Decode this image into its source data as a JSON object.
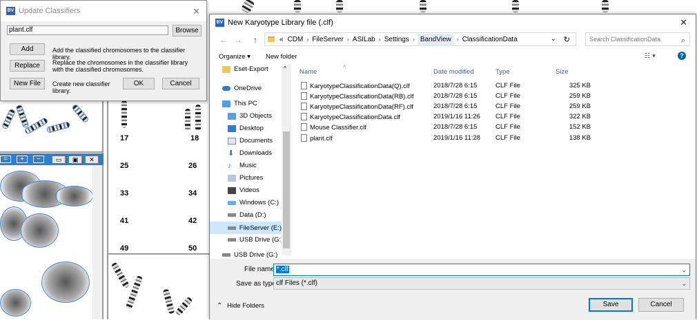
{
  "update_dialog": {
    "title": "Update Classifiers",
    "file_value": "plant.clf",
    "browse_label": "Browse",
    "add_label": "Add",
    "add_desc": "Add the classified chromosomes to the classifier library.",
    "replace_label": "Replace",
    "replace_desc": "Replace the chromosomes in the classifier library with the classified chromosomes.",
    "new_file_label": "New File",
    "new_file_desc": "Create new classifier library.",
    "ok_label": "OK",
    "cancel_label": "Cancel",
    "close_glyph": "✕"
  },
  "background": {
    "karyotype_numbers": [
      "17",
      "18",
      "25",
      "26",
      "33",
      "34",
      "41",
      "42",
      "49",
      "50"
    ],
    "toolbar_button_glyphs": [
      "=",
      "+",
      "−"
    ],
    "window_button_glyphs": [
      "▭",
      "▣",
      "✕"
    ]
  },
  "save_dialog": {
    "title": "New Karyotype Library  file (.clf)",
    "close_glyph": "✕",
    "back_glyph": "←",
    "forward_glyph": "→",
    "up_glyph": "↑",
    "refresh_glyph": "↻",
    "dropdown_glyph": "⌄",
    "breadcrumbs": {
      "overflow": "«",
      "items": [
        "CDM",
        "FileServer",
        "ASILab",
        "Settings",
        "BandView",
        "ClassificationData"
      ],
      "separator": "›"
    },
    "search_placeholder": "Search ClassificationData",
    "search_glyph": "⌕",
    "organize_label": "Organize ▾",
    "new_folder_label": "New folder",
    "view_glyph": "☷ ▾",
    "help_glyph": "?",
    "nav_items": [
      {
        "label": "Eset-Export",
        "icon": "folder-icon"
      },
      {
        "label": "OneDrive",
        "icon": "cloud-icon"
      },
      {
        "label": "This PC",
        "icon": "computer-icon"
      },
      {
        "label": "3D Objects",
        "icon": "cube-icon"
      },
      {
        "label": "Desktop",
        "icon": "desktop-icon"
      },
      {
        "label": "Documents",
        "icon": "documents-icon"
      },
      {
        "label": "Downloads",
        "icon": "download-icon"
      },
      {
        "label": "Music",
        "icon": "music-icon"
      },
      {
        "label": "Pictures",
        "icon": "pictures-icon"
      },
      {
        "label": "Videos",
        "icon": "videos-icon"
      },
      {
        "label": "Windows (C:)",
        "icon": "drive-icon"
      },
      {
        "label": "Data (D:)",
        "icon": "drive-icon"
      },
      {
        "label": "FileServer (E:)",
        "icon": "drive-icon"
      },
      {
        "label": "USB Drive (G:)",
        "icon": "usb-drive-icon"
      },
      {
        "label": "USB Drive (G:)",
        "icon": "usb-drive-icon"
      }
    ],
    "columns": [
      "Name",
      "Date modified",
      "Type",
      "Size"
    ],
    "sort_glyph": "^",
    "files": [
      {
        "name": "KaryotypeClassificationData(Q).clf",
        "date": "2018/7/28 6:15",
        "type": "CLF File",
        "size": "325 KB"
      },
      {
        "name": "KaryotypeClassificationData(RB).clf",
        "date": "2018/7/28 6:15",
        "type": "CLF File",
        "size": "259 KB"
      },
      {
        "name": "KaryotypeClassificationData(RF).clf",
        "date": "2018/7/28 6:15",
        "type": "CLF File",
        "size": "259 KB"
      },
      {
        "name": "KaryotypeClassificationData.clf",
        "date": "2019/1/16 11:26",
        "type": "CLF File",
        "size": "322 KB"
      },
      {
        "name": "Mouse Classifier.clf",
        "date": "2018/7/28 6:15",
        "type": "CLF File",
        "size": "152 KB"
      },
      {
        "name": "plant.clf",
        "date": "2019/1/16 11:28",
        "type": "CLF File",
        "size": "138 KB"
      }
    ],
    "file_name_label": "File name:",
    "file_name_value": "*.clf",
    "save_as_type_label": "Save as type:",
    "save_as_type_value": "clf Files (*.clf)",
    "hide_folders_label": "Hide Folders",
    "hide_folders_glyph": "⌃",
    "save_label": "Save",
    "cancel_label": "Cancel"
  }
}
